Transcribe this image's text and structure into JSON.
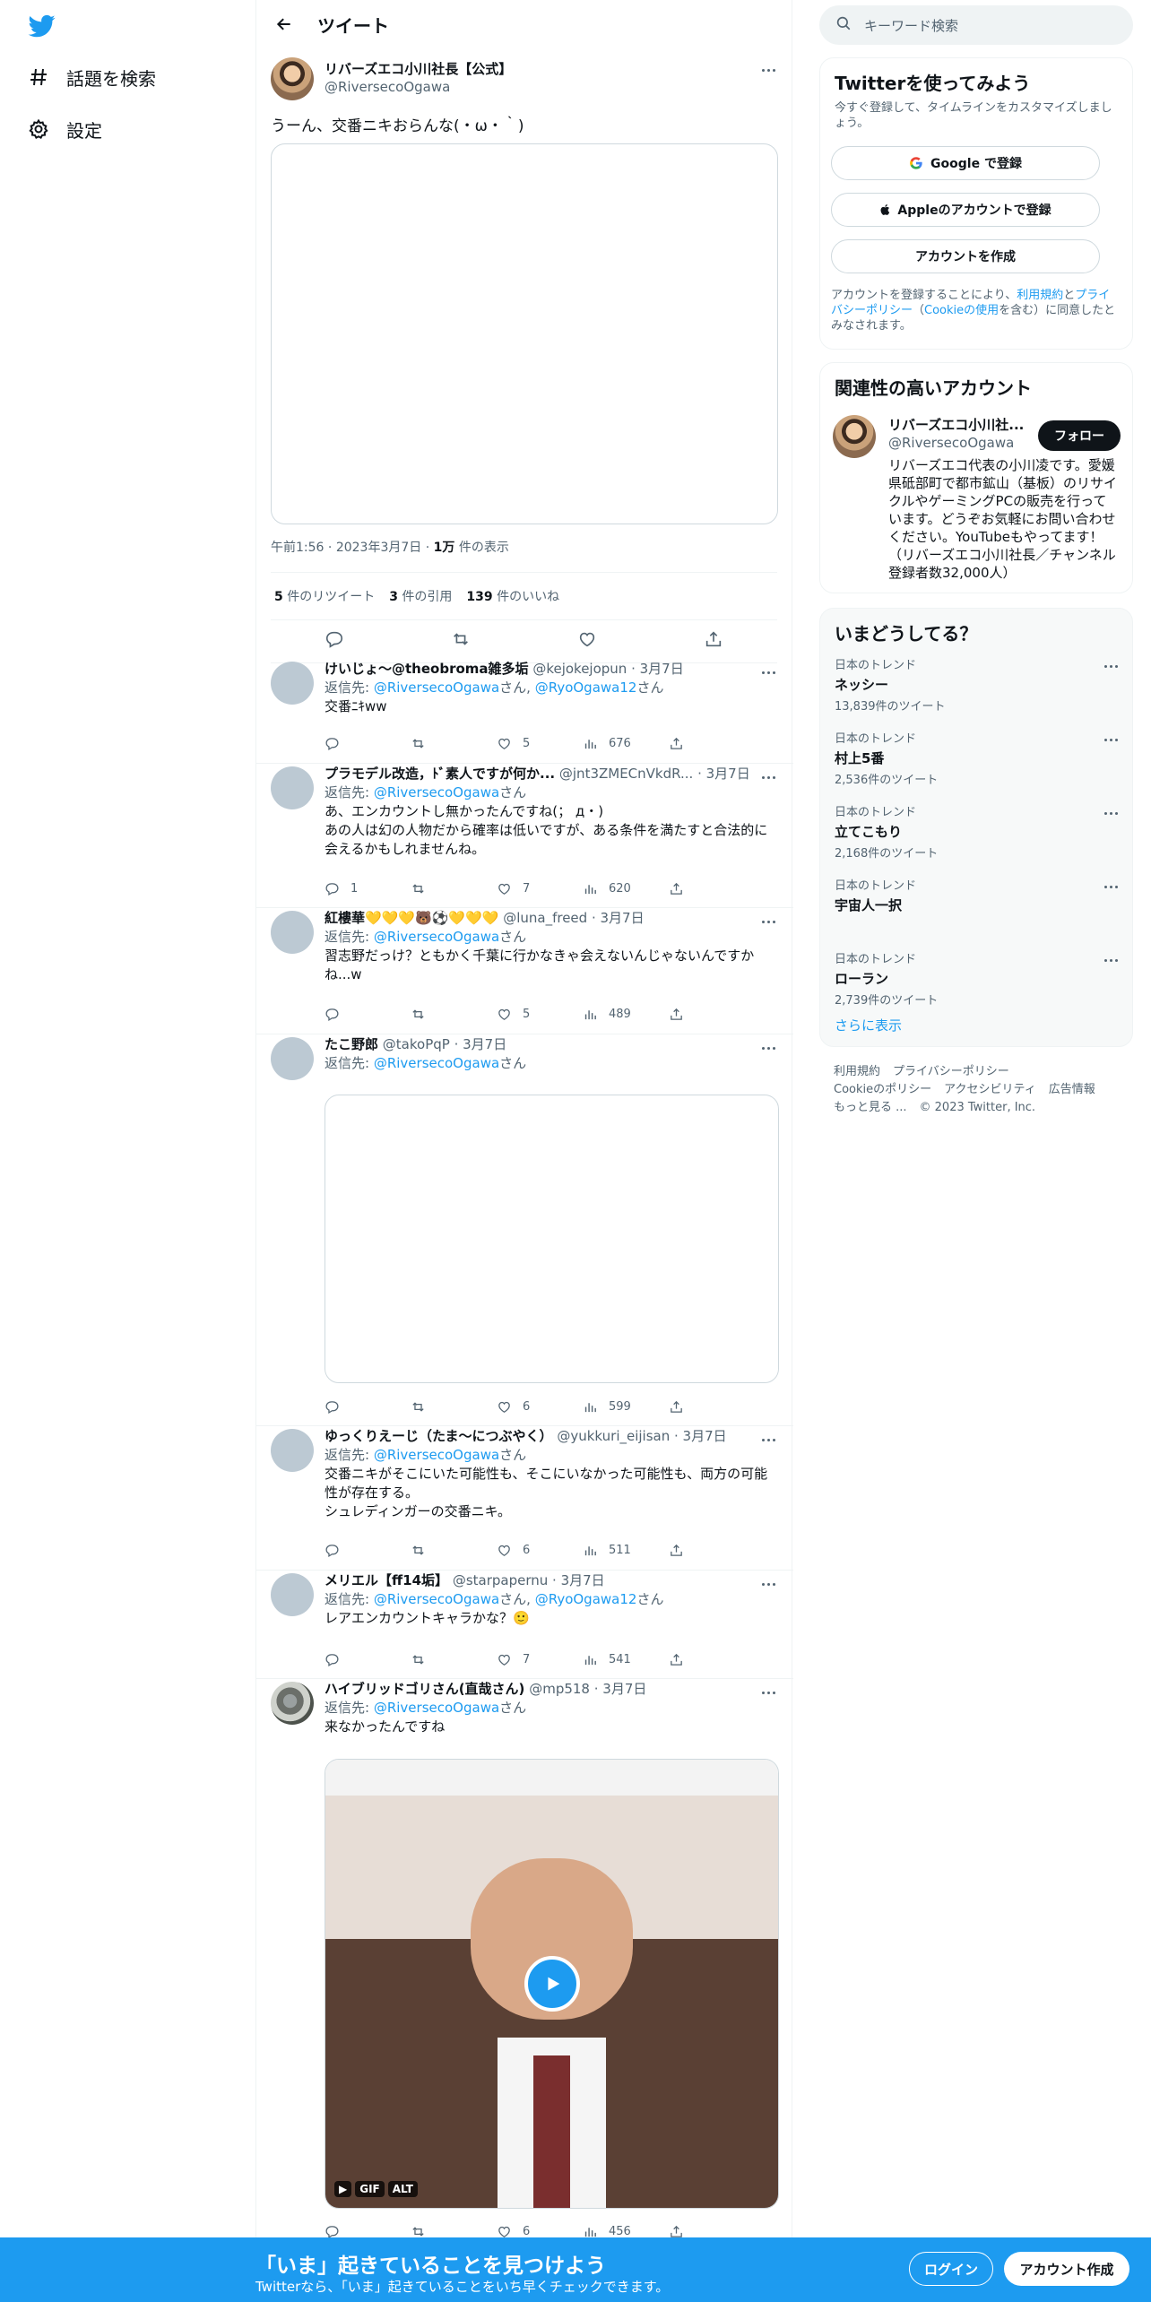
{
  "nav": {
    "explore": "話題を検索",
    "settings": "設定"
  },
  "header": {
    "title": "ツイート"
  },
  "tweet": {
    "name": "リバーズエコ小川社長【公式】",
    "handle": "@RiversecoOgawa",
    "text": "うーん、交番ニキおらんな(・ω・｀)",
    "time": "午前1:56",
    "date": "2023年3月7日",
    "views_num": "1万",
    "views_label": "件の表示",
    "retweets": "5",
    "retweets_label": "件のリツイート",
    "quotes": "3",
    "quotes_label": "件の引用",
    "likes": "139",
    "likes_label": "件のいいね"
  },
  "reply_label": "返信先:",
  "san": "さん",
  "replies": [
    {
      "name": "けいじょ〜@theobroma雑多垢",
      "handle": "@kejokejopun",
      "date": "3月7日",
      "to": "@RiversecoOgawa",
      "to2": "@RyoOgawa12",
      "lines": [
        "交番ﾆｷww"
      ],
      "replies": "",
      "likes": "5",
      "views": "676"
    },
    {
      "name": "プラモデル改造，ﾄﾞ素人ですが何か...",
      "handle": "@jnt3ZMECnVkdR...",
      "date": "3月7日",
      "to": "@RiversecoOgawa",
      "lines": [
        "あ、エンカウントし無かったんですね(； д・)",
        "あの人は幻の人物だから確率は低いですが、ある条件を満たすと合法的に会えるかもしれませんね。"
      ],
      "replies": "1",
      "likes": "7",
      "views": "620"
    },
    {
      "name": "紅樓華💛💛💛🐻⚽💛💛💛",
      "handle": "@luna_freed",
      "date": "3月7日",
      "to": "@RiversecoOgawa",
      "lines": [
        "習志野だっけ？ともかく千葉に行かなきゃ会えないんじゃないんですかね...w"
      ],
      "replies": "",
      "likes": "5",
      "views": "489"
    },
    {
      "name": "たこ野郎",
      "handle": "@takoPqP",
      "date": "3月7日",
      "to": "@RiversecoOgawa",
      "lines": [],
      "replies": "",
      "likes": "6",
      "views": "599"
    },
    {
      "name": "ゆっくりえーじ（たま〜につぶやく）",
      "handle": "@yukkuri_eijisan",
      "date": "3月7日",
      "to": "@RiversecoOgawa",
      "lines": [
        "交番ニキがそこにいた可能性も、そこにいなかった可能性も、両方の可能性が存在する。",
        "シュレディンガーの交番ニキ。"
      ],
      "replies": "",
      "likes": "6",
      "views": "511"
    },
    {
      "name": "メリエル【ff14垢】",
      "handle": "@starpapernu",
      "date": "3月7日",
      "to": "@RiversecoOgawa",
      "to2": "@RyoOgawa12",
      "lines": [
        "レアエンカウントキャラかな？🙂"
      ],
      "replies": "",
      "likes": "7",
      "views": "541"
    },
    {
      "name": "ハイブリッドゴリさん(直哉さん)",
      "handle": "@mp518",
      "date": "3月7日",
      "to": "@RiversecoOgawa",
      "lines": [
        "来なかったんですね"
      ],
      "replies": "",
      "likes": "6",
      "views": "456",
      "gif": "GIF",
      "alt": "ALT"
    }
  ],
  "search": {
    "placeholder": "キーワード検索"
  },
  "signup": {
    "title": "Twitterを使ってみよう",
    "subtitle": "今すぐ登録して、タイムラインをカスタマイズしましょう。",
    "google": "Google で登録",
    "apple": "Appleのアカウントで登録",
    "create": "アカウントを作成",
    "terms_pre": "アカウントを登録することにより、",
    "terms_link": "利用規約",
    "terms_and": "と",
    "privacy_link": "プライバシーポリシー",
    "paren_open": "（",
    "cookie_link": "Cookieの使用",
    "terms_post": "を含む）に同意したとみなされます。"
  },
  "related": {
    "title": "関連性の高いアカウント",
    "name": "リバーズエコ小川社...",
    "handle": "@RiversecoOgawa",
    "follow": "フォロー",
    "bio": "リバーズエコ代表の小川凌です。愛媛県砥部町で都市鉱山（基板）のリサイクルやゲーミングPCの販売を行っています。どうぞお気軽にお問い合わせください。YouTubeもやってます！（リバーズエコ小川社長／チャンネル登録者数32,000人）"
  },
  "trends": {
    "title": "いまどうしてる？",
    "items": [
      {
        "cat": "日本のトレンド",
        "name": "ネッシー",
        "count": "13,839件のツイート"
      },
      {
        "cat": "日本のトレンド",
        "name": "村上5番",
        "count": "2,536件のツイート"
      },
      {
        "cat": "日本のトレンド",
        "name": "立てこもり",
        "count": "2,168件のツイート"
      },
      {
        "cat": "日本のトレンド",
        "name": "宇宙人一択",
        "count": ""
      },
      {
        "cat": "日本のトレンド",
        "name": "ローラン",
        "count": "2,739件のツイート"
      }
    ],
    "more": "さらに表示"
  },
  "footer": {
    "links1": [
      "利用規約",
      "プライバシーポリシー"
    ],
    "links2": [
      "Cookieのポリシー",
      "アクセシビリティ",
      "広告情報"
    ],
    "more": "もっと見る ...",
    "copyright": "© 2023 Twitter, Inc."
  },
  "bottombar": {
    "title": "「いま」起きていることを見つけよう",
    "subtitle": "Twitterなら、「いま」起きていることをいち早くチェックできます。",
    "login": "ログイン",
    "signup": "アカウント作成"
  },
  "colors": {
    "brand": "#1d9bf0",
    "text": "#0f1419",
    "muted": "#536471"
  }
}
